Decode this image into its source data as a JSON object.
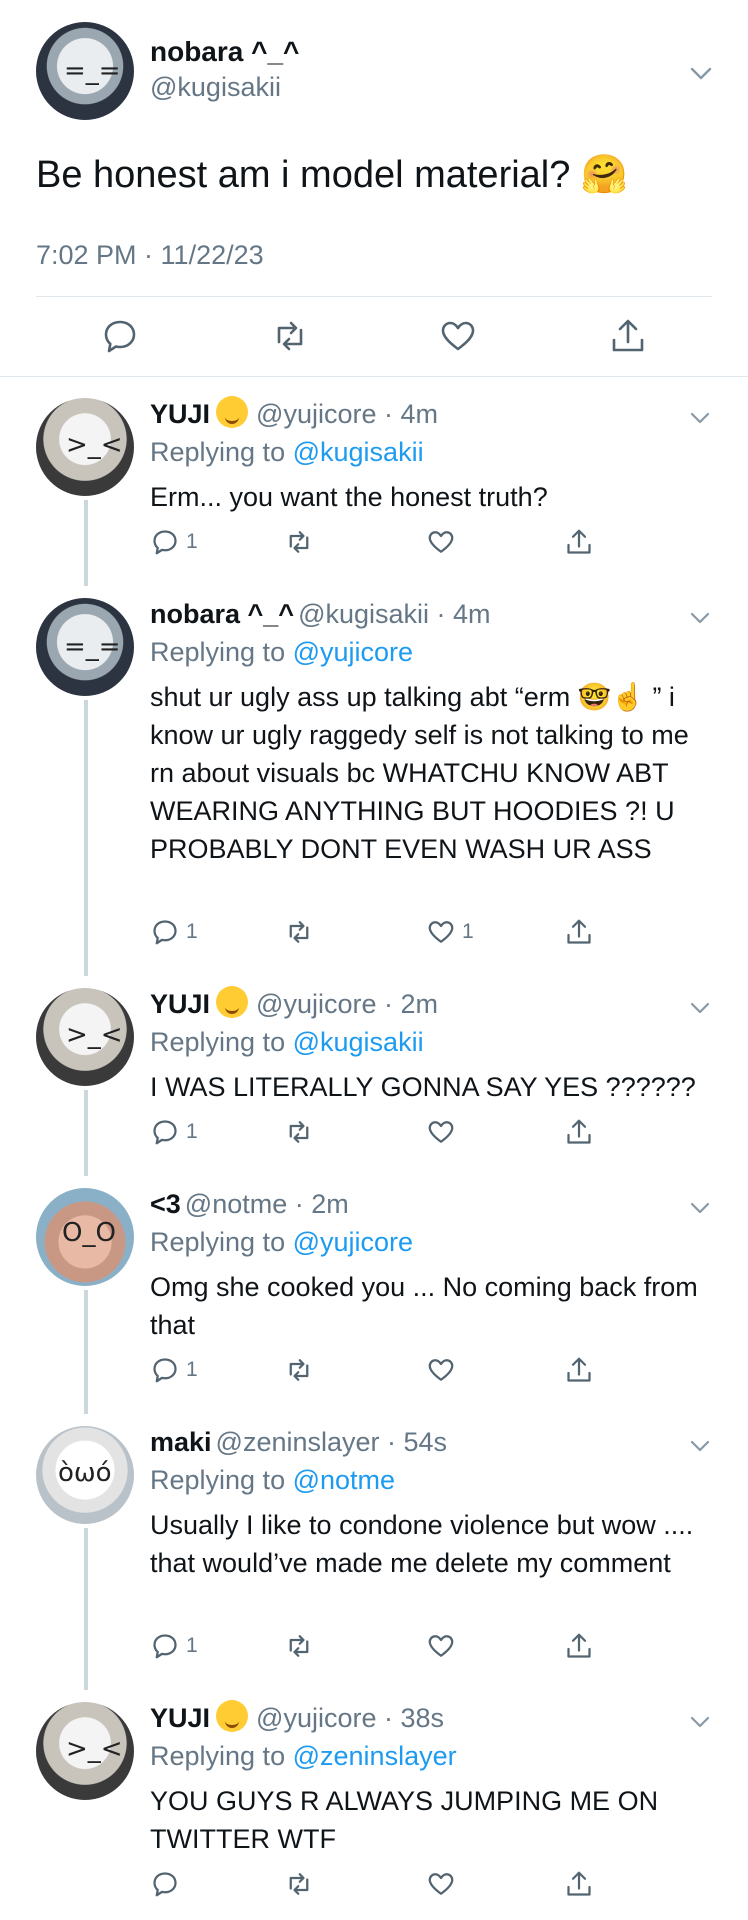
{
  "colors": {
    "text": "#0f1419",
    "secondary": "#657786",
    "link": "#1d9bf0",
    "divider": "#e1e8ed",
    "thread_line": "#ccd6dd"
  },
  "main_tweet": {
    "name": "nobara ^_^",
    "handle": "@kugisakii",
    "text": "Be honest am i model material? 🤗",
    "timestamp": "7:02 PM · 11/22/23",
    "actions": [
      "reply-icon",
      "retweet-icon",
      "like-icon",
      "share-icon"
    ]
  },
  "replies": [
    {
      "name": "YUJI",
      "has_emoji": true,
      "handle": "@yujicore · 4m",
      "replying_prefix": "Replying to",
      "replying_to": "@kugisakii",
      "text": "Erm... you want the honest truth?",
      "reply_count": "1",
      "like_count": ""
    },
    {
      "name": "nobara ^_^",
      "has_emoji": false,
      "handle": "@kugisakii · 4m",
      "replying_prefix": "Replying to",
      "replying_to": "@yujicore",
      "text": "shut ur ugly ass up talking abt “erm 🤓☝️ ” i know ur ugly raggedy self is not talking to me rn about visuals bc WHATCHU KNOW ABT WEARING ANYTHING BUT HOODIES ?! U PROBABLY DONT EVEN WASH UR ASS",
      "reply_count": "1",
      "like_count": "1"
    },
    {
      "name": "YUJI",
      "has_emoji": true,
      "handle": "@yujicore · 2m",
      "replying_prefix": "Replying to",
      "replying_to": "@kugisakii",
      "text": "I WAS LITERALLY GONNA SAY YES ??????",
      "reply_count": "1",
      "like_count": ""
    },
    {
      "name": "<3",
      "has_emoji": false,
      "handle": "@notme · 2m",
      "replying_prefix": "Replying to",
      "replying_to": "@yujicore",
      "text": "Omg she cooked you ... No coming back from that",
      "reply_count": "1",
      "like_count": ""
    },
    {
      "name": "maki",
      "has_emoji": false,
      "handle": "@zeninslayer · 54s",
      "replying_prefix": "Replying to",
      "replying_to": "@notme",
      "text": "Usually I like to condone violence but wow .... that would’ve made me delete my comment",
      "reply_count": "1",
      "like_count": ""
    },
    {
      "name": "YUJI",
      "has_emoji": true,
      "handle": "@yujicore · 38s",
      "replying_prefix": "Replying to",
      "replying_to": "@zeninslayer",
      "text": "YOU GUYS R ALWAYS JUMPING ME ON TWITTER WTF",
      "reply_count": "",
      "like_count": ""
    }
  ]
}
